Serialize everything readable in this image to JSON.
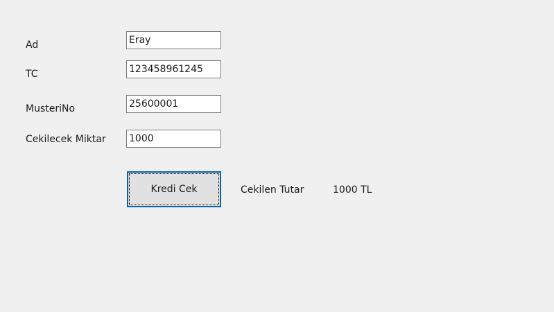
{
  "form": {
    "ad_label": "Ad",
    "ad_value": "Eray",
    "tc_label": "TC",
    "tc_value": "123458961245",
    "musterino_label": "MusteriNo",
    "musterino_value": "25600001",
    "miktar_label": "Cekilecek Miktar",
    "miktar_value": "1000",
    "submit_label": "Kredi Cek",
    "result_label": "Cekilen Tutar",
    "result_value": "1000 TL"
  }
}
